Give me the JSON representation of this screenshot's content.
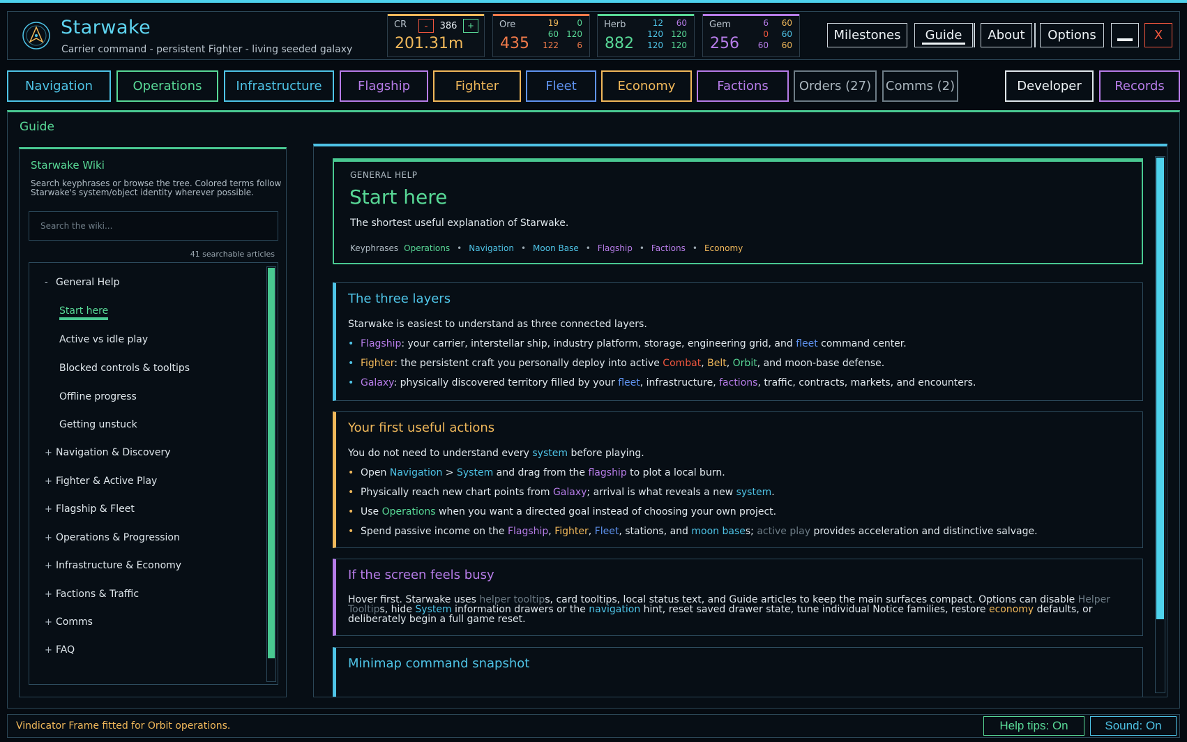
{
  "app": {
    "title": "Starwake",
    "subtitle": "Carrier command - persistent Fighter - living seeded galaxy",
    "logo_icon": "carrier-emblem-icon"
  },
  "resources": {
    "cr": {
      "label": "CR",
      "minus": "-",
      "plus": "+",
      "step": "386",
      "value": "201.31m",
      "color": "#f0b85a"
    },
    "ore": {
      "label": "Ore",
      "value": "435",
      "color": "#f07a4a",
      "grid": [
        "19",
        "0",
        "60",
        "120",
        "122",
        "6"
      ]
    },
    "herb": {
      "label": "Herb",
      "value": "882",
      "color": "#58d896",
      "grid": [
        "12",
        "60",
        "120",
        "120",
        "120",
        "120"
      ]
    },
    "gem": {
      "label": "Gem",
      "value": "256",
      "color": "#b67ce8",
      "grid": [
        "6",
        "60",
        "0",
        "60",
        "60",
        "60"
      ]
    }
  },
  "top_buttons": {
    "milestones": "Milestones",
    "guide": "Guide",
    "about": "About",
    "options": "Options",
    "minimize_icon": "minimize-icon",
    "close": "X"
  },
  "tabs": [
    {
      "label": "Navigation",
      "color": "#4ec3e6"
    },
    {
      "label": "Operations",
      "color": "#58d896"
    },
    {
      "label": "Infrastructure",
      "color": "#4ec3e6"
    },
    {
      "label": "Flagship",
      "color": "#b67ce8"
    },
    {
      "label": "Fighter",
      "color": "#f0b85a"
    },
    {
      "label": "Fleet",
      "color": "#5f93f0"
    },
    {
      "label": "Economy",
      "color": "#f0b85a"
    },
    {
      "label": "Factions",
      "color": "#b67ce8"
    },
    {
      "label": "Orders (27)",
      "color": "#9aa7b0"
    },
    {
      "label": "Comms (2)",
      "color": "#9aa7b0"
    },
    {
      "label": "Developer",
      "color": "#eef3f6"
    },
    {
      "label": "Records",
      "color": "#b67ce8"
    }
  ],
  "guide": {
    "title": "Guide",
    "wiki": {
      "title": "Starwake Wiki",
      "description": "Search keyphrases or browse the tree. Colored terms follow Starwake's system/object identity wherever possible.",
      "search_placeholder": "Search the wiki...",
      "count": "41 searchable articles",
      "tree": [
        {
          "sign": "-",
          "label": "General Help"
        },
        {
          "sign": "",
          "label": "Start here"
        },
        {
          "sign": "",
          "label": "Active vs idle play"
        },
        {
          "sign": "",
          "label": "Blocked controls & tooltips"
        },
        {
          "sign": "",
          "label": "Offline progress"
        },
        {
          "sign": "",
          "label": "Getting unstuck"
        },
        {
          "sign": "+",
          "label": "Navigation & Discovery"
        },
        {
          "sign": "+",
          "label": "Fighter & Active Play"
        },
        {
          "sign": "+",
          "label": "Flagship & Fleet"
        },
        {
          "sign": "+",
          "label": "Operations & Progression"
        },
        {
          "sign": "+",
          "label": "Infrastructure & Economy"
        },
        {
          "sign": "+",
          "label": "Factions & Traffic"
        },
        {
          "sign": "+",
          "label": "Comms"
        },
        {
          "sign": "+",
          "label": "FAQ"
        }
      ]
    },
    "article": {
      "kicker": "GENERAL HELP",
      "title": "Start here",
      "description": "The shortest useful explanation of Starwake.",
      "keyphrases_label": "Keyphrases",
      "keyphrases": [
        "Operations",
        "Navigation",
        "Moon Base",
        "Flagship",
        "Factions",
        "Economy"
      ],
      "bullet_separator": "•",
      "sections": {
        "layers": {
          "title": "The three layers",
          "intro": "Starwake is easiest to understand as three connected layers.",
          "l1": {
            "a": "Flagship",
            "b": ": your carrier, interstellar ship, industry platform, storage, engineering grid, and ",
            "c": "fleet",
            "d": " command center."
          },
          "l2": {
            "a": "Fighter",
            "b": ": the persistent craft you personally deploy into active ",
            "c": "Combat",
            "d": ", ",
            "e": "Belt",
            "f": ", ",
            "g": "Orbit",
            "h": ", and moon-base defense."
          },
          "l3": {
            "a": "Galaxy",
            "b": ": physically discovered territory filled by your ",
            "c": "fleet",
            "d": ", infrastructure, ",
            "e": "factions",
            "f": ", traffic, contracts, markets, and encounters."
          }
        },
        "actions": {
          "title": "Your first useful actions",
          "intro_a": "You do not need to understand every ",
          "intro_b": "system",
          "intro_c": " before playing.",
          "a1": {
            "a": "Open ",
            "b": "Navigation",
            "c": " > ",
            "d": "System",
            "e": " and drag from the ",
            "f": "flagship",
            "g": " to plot a local burn."
          },
          "a2": {
            "a": "Physically reach new chart points from ",
            "b": "Galaxy",
            "c": "; arrival is what reveals a new ",
            "d": "system",
            "e": "."
          },
          "a3": {
            "a": "Use ",
            "b": "Operations",
            "c": " when you want a directed goal instead of choosing your own project."
          },
          "a4": {
            "a": "Spend passive income on the ",
            "b": "Flagship",
            "c": ", ",
            "d": "Fighter",
            "e": ", ",
            "f": "Fleet",
            "g": ", stations, and ",
            "h": "moon base",
            "i": "s; ",
            "j": "active play",
            "k": " provides acceleration and distinctive salvage."
          }
        },
        "busy": {
          "title": "If the screen feels busy",
          "p": {
            "a": "Hover first. Starwake uses ",
            "b": "helper tooltip",
            "c": "s, card tooltips, local status text, and Guide articles to keep the main surfaces compact. Options can disable ",
            "d": "Helper Tooltip",
            "e": "s, hide ",
            "f": "System",
            "g": " information drawers or the ",
            "h": "navigation",
            "i": " hint, reset saved drawer state, tune individual Notice families, restore ",
            "j": "economy",
            "k": " defaults, or deliberately begin a full game reset."
          }
        },
        "minimap": {
          "title": "Minimap command snapshot"
        }
      }
    }
  },
  "status": {
    "message": "Vindicator Frame fitted for Orbit operations.",
    "help_tips": "Help tips: On",
    "sound": "Sound: On"
  }
}
